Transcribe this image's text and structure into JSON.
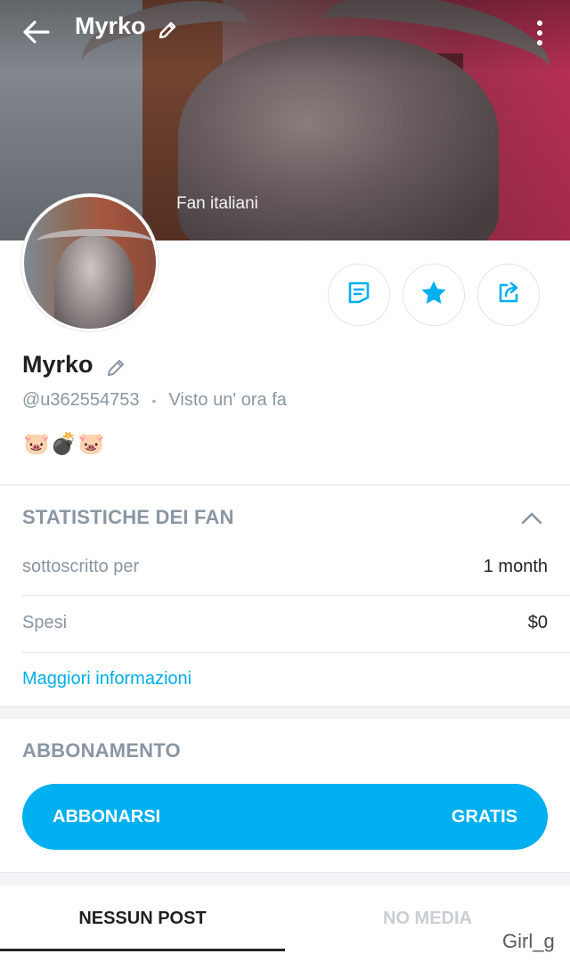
{
  "header": {
    "title": "Myrko",
    "cover_label": "Fan italiani"
  },
  "profile": {
    "name": "Myrko",
    "handle": "@u362554753",
    "separator": "•",
    "last_seen": "Visto  un' ora fa",
    "bio_emojis": "🐷💣🐷"
  },
  "actions": {
    "icons": [
      "message-icon",
      "star-icon",
      "share-icon"
    ]
  },
  "fan_stats": {
    "title": "STATISTICHE DEI FAN",
    "rows": [
      {
        "label": "sottoscritto per",
        "value": "1 month"
      },
      {
        "label": "Spesi",
        "value": "$0"
      }
    ],
    "more_link": "Maggiori informazioni"
  },
  "subscription": {
    "title": "ABBONAMENTO",
    "button_left": "ABBONARSI",
    "button_right": "GRATIS"
  },
  "tabs": [
    {
      "label": "NESSUN POST",
      "active": true
    },
    {
      "label": "NO MEDIA",
      "active": false
    }
  ],
  "watermark": "Girl_g",
  "colors": {
    "accent": "#00aff0",
    "muted_text": "#8a96a3",
    "primary_text": "#242529"
  }
}
